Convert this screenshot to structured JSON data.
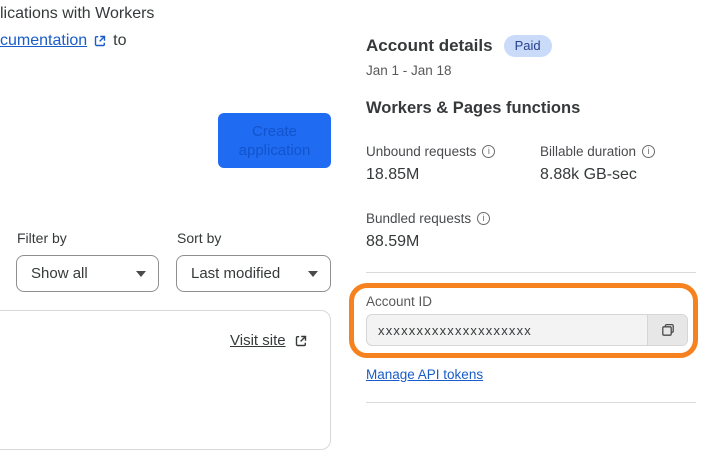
{
  "left_panel": {
    "intro_line1": "lications with Workers",
    "intro_link_text": "cumentation",
    "intro_line2_suffix": "to",
    "create_button_label": "Create application",
    "filter": {
      "label": "Filter by",
      "selected": "Show all"
    },
    "sort": {
      "label": "Sort by",
      "selected": "Last modified"
    },
    "card": {
      "visit_site_label": "Visit site"
    }
  },
  "account_panel": {
    "title": "Account details",
    "badge": "Paid",
    "date_range": "Jan 1 - Jan 18",
    "section_title": "Workers & Pages functions",
    "metrics": [
      {
        "label": "Unbound requests",
        "value": "18.85M"
      },
      {
        "label": "Billable duration",
        "value": "8.88k GB-sec"
      },
      {
        "label": "Bundled requests",
        "value": "88.59M"
      }
    ],
    "account_id": {
      "label": "Account ID",
      "value": "xxxxxxxxxxxxxxxxxxxx"
    },
    "manage_link_label": "Manage API tokens"
  },
  "colors": {
    "accent_orange_highlight": "#f6821f",
    "button_blue": "#1f6bf2",
    "button_text_blue": "#1254cd",
    "link_blue": "#1a5cc8",
    "badge_bg": "#c9dbf9",
    "badge_text": "#27418c",
    "divider_gray": "#d9d9d9",
    "input_bg": "#f3f3f3"
  }
}
